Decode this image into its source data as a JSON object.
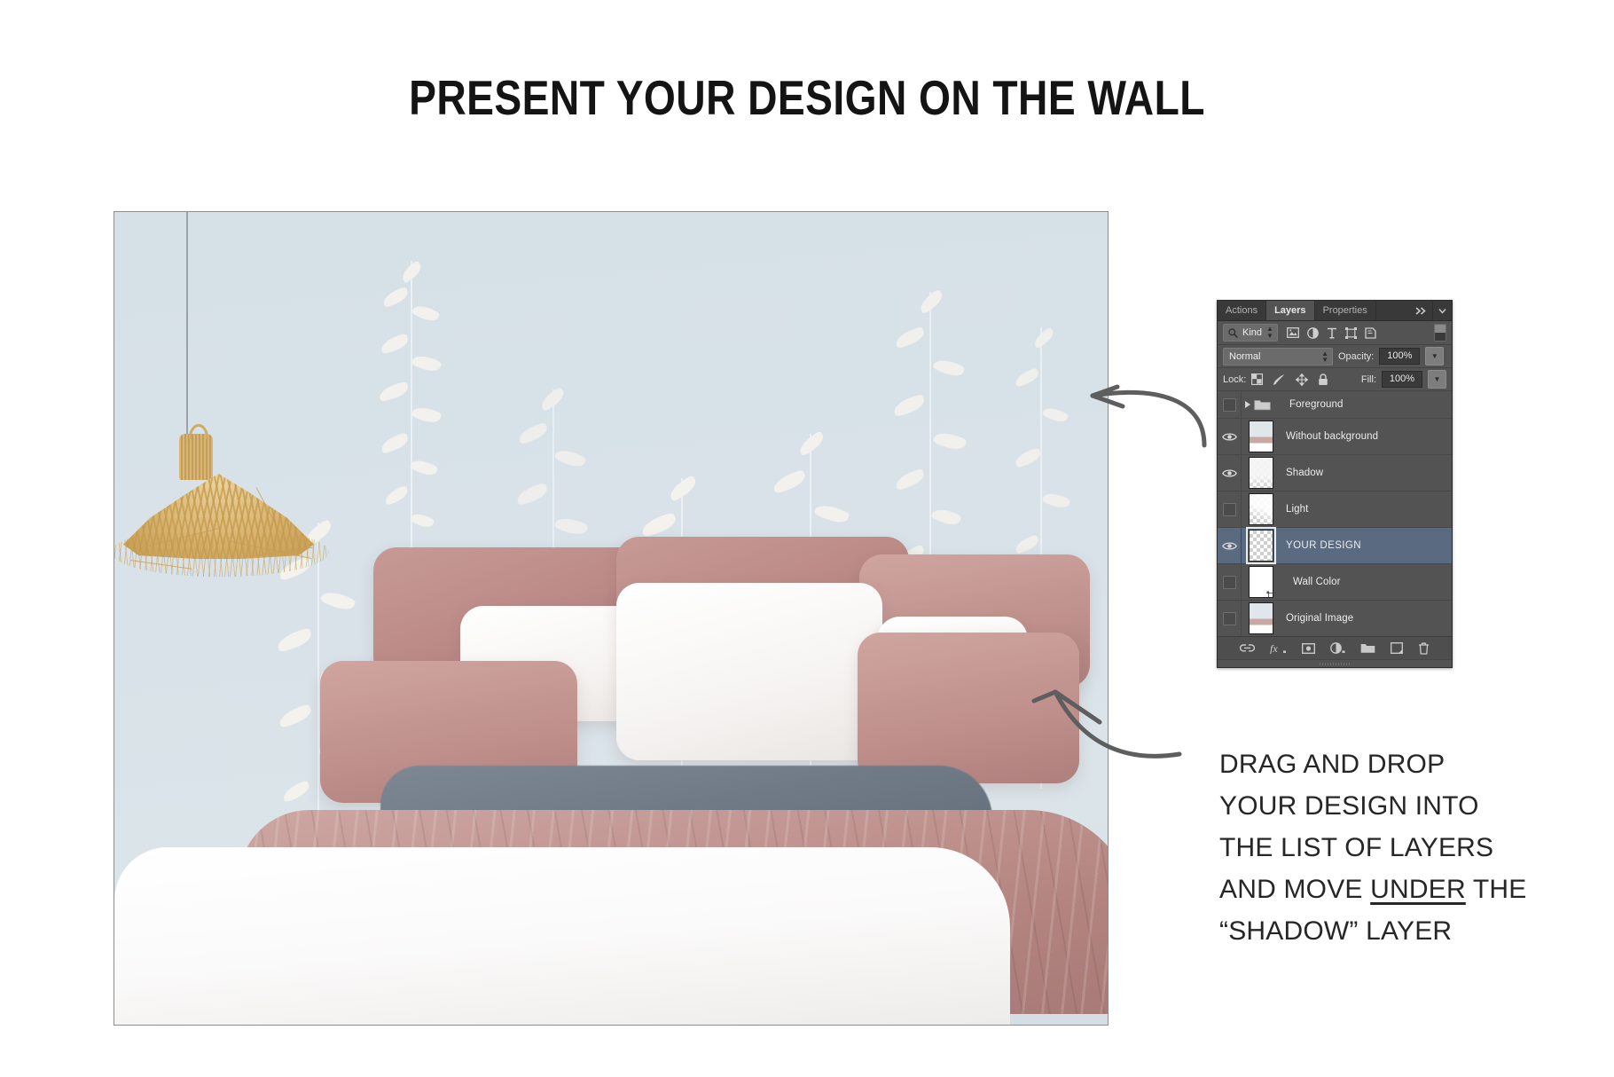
{
  "page": {
    "title": "PRESENT YOUR DESIGN ON THE WALL",
    "background_color": "#ffffff"
  },
  "mockup": {
    "name": "bedroom-wall-mockup",
    "wall_color": "#d6e1e7",
    "accent_colors": {
      "wall_blue": "#d6e1e7",
      "botanical_white": "#f6f3ee",
      "pillow_rose": "#bd8c89",
      "blanket_grey": "#6d7884",
      "rattan_gold": "#d6b97f"
    }
  },
  "panel": {
    "tabs": [
      {
        "label": "Actions",
        "active": false
      },
      {
        "label": "Layers",
        "active": true
      },
      {
        "label": "Properties",
        "active": false
      }
    ],
    "tab_overflow_icon": "double-chevron-right-icon",
    "tab_menu_icon": "panel-menu-icon",
    "filter": {
      "search_icon": "search-icon",
      "kind_label": "Kind",
      "kind_spinner_icon": "updown-spinner-icon",
      "filter_icons": [
        "pixel-layer-filter-icon",
        "adjustment-layer-filter-icon",
        "type-layer-filter-icon",
        "shape-layer-filter-icon",
        "smart-object-filter-icon"
      ],
      "filter_toggle_icon": "filter-enable-toggle-icon"
    },
    "blend": {
      "mode_value": "Normal",
      "mode_caret_icon": "updown-spinner-icon",
      "opacity_label": "Opacity:",
      "opacity_value": "100%",
      "opacity_caret_icon": "chevron-down-icon"
    },
    "lock": {
      "lock_label": "Lock:",
      "icons": [
        "lock-transparent-pixels-icon",
        "lock-image-pixels-icon",
        "lock-position-icon",
        "lock-all-icon"
      ],
      "fill_label": "Fill:",
      "fill_value": "100%",
      "fill_caret_icon": "chevron-down-icon"
    },
    "layers": [
      {
        "name": "Foreground",
        "visible": false,
        "selected": false,
        "type": "group",
        "icons": [
          "expand-triangle-icon",
          "folder-icon"
        ]
      },
      {
        "name": "Without background",
        "visible": true,
        "selected": false,
        "type": "image",
        "thumb": "photo"
      },
      {
        "name": "Shadow",
        "visible": true,
        "selected": false,
        "type": "image",
        "thumb": "shadow"
      },
      {
        "name": "Light",
        "visible": false,
        "selected": false,
        "type": "image",
        "thumb": "light"
      },
      {
        "name": "YOUR DESIGN",
        "visible": true,
        "selected": true,
        "type": "smart-object",
        "thumb": "empty"
      },
      {
        "name": "Wall Color",
        "visible": false,
        "selected": false,
        "type": "fill",
        "thumb": "white"
      },
      {
        "name": "Original Image",
        "visible": false,
        "selected": false,
        "type": "image",
        "thumb": "photo"
      }
    ],
    "footer_icons": [
      "link-layers-icon",
      "layer-style-fx-icon",
      "layer-mask-icon",
      "adjustment-layer-icon",
      "new-group-icon",
      "new-layer-icon",
      "delete-layer-icon"
    ],
    "selected_layer_highlight": "#5a6a80"
  },
  "annotations": {
    "arrow_top": "curved-arrow-pointing-to-wall",
    "arrow_bottom": "curved-arrow-pointing-to-bed-wall",
    "instruction_lines": [
      "DRAG AND DROP",
      "YOUR DESIGN INTO",
      "THE LIST OF LAYERS",
      "AND MOVE UNDER THE",
      "“SHADOW” LAYER"
    ],
    "instruction_emphasis_word": "UNDER",
    "instruction_line4_pre": "AND MOVE ",
    "instruction_line4_post": " THE"
  }
}
